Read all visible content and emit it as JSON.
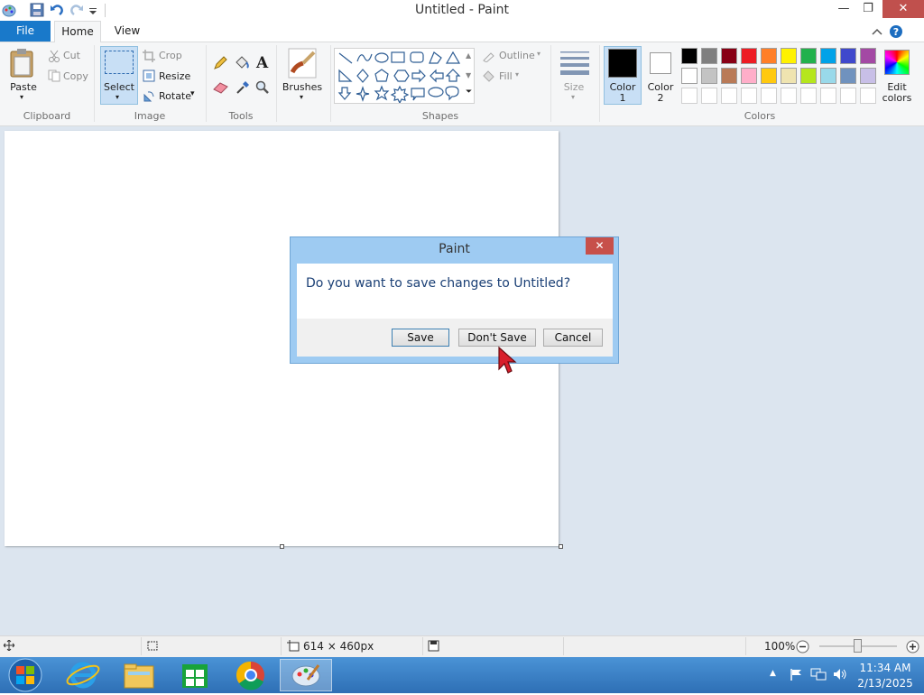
{
  "window": {
    "title": "Untitled - Paint"
  },
  "window_controls": {
    "minimize": "—",
    "restore": "❐",
    "close": "✕"
  },
  "tabs": {
    "file": "File",
    "home": "Home",
    "view": "View"
  },
  "ribbon": {
    "clipboard": {
      "paste": "Paste",
      "cut": "Cut",
      "copy": "Copy",
      "group": "Clipboard"
    },
    "image": {
      "select": "Select",
      "crop": "Crop",
      "resize": "Resize",
      "rotate": "Rotate",
      "group": "Image"
    },
    "tools": {
      "group": "Tools"
    },
    "brushes": {
      "label": "Brushes"
    },
    "shapes": {
      "outline": "Outline",
      "fill": "Fill",
      "group": "Shapes"
    },
    "size": {
      "label": "Size"
    },
    "colors": {
      "color1_line1": "Color",
      "color1_line2": "1",
      "color2_line1": "Color",
      "color2_line2": "2",
      "edit_line1": "Edit",
      "edit_line2": "colors",
      "group": "Colors",
      "color1_value": "#000000",
      "color2_value": "#ffffff",
      "palette_row1": [
        "#000000",
        "#7f7f7f",
        "#880015",
        "#ed1c24",
        "#ff7f27",
        "#fff200",
        "#22b14c",
        "#00a2e8",
        "#3f48cc",
        "#a349a4"
      ],
      "palette_row2": [
        "#ffffff",
        "#c3c3c3",
        "#b97a57",
        "#ffaec9",
        "#ffc90e",
        "#efe4b0",
        "#b5e61d",
        "#99d9ea",
        "#7092be",
        "#c8bfe7"
      ]
    }
  },
  "dialog": {
    "title": "Paint",
    "message": "Do you want to save changes to Untitled?",
    "save": "Save",
    "dont_save": "Don't Save",
    "cancel": "Cancel"
  },
  "status": {
    "dimensions": "614 × 460px",
    "zoom": "100%"
  },
  "taskbar": {
    "time": "11:34 AM",
    "date": "2/13/2025"
  }
}
